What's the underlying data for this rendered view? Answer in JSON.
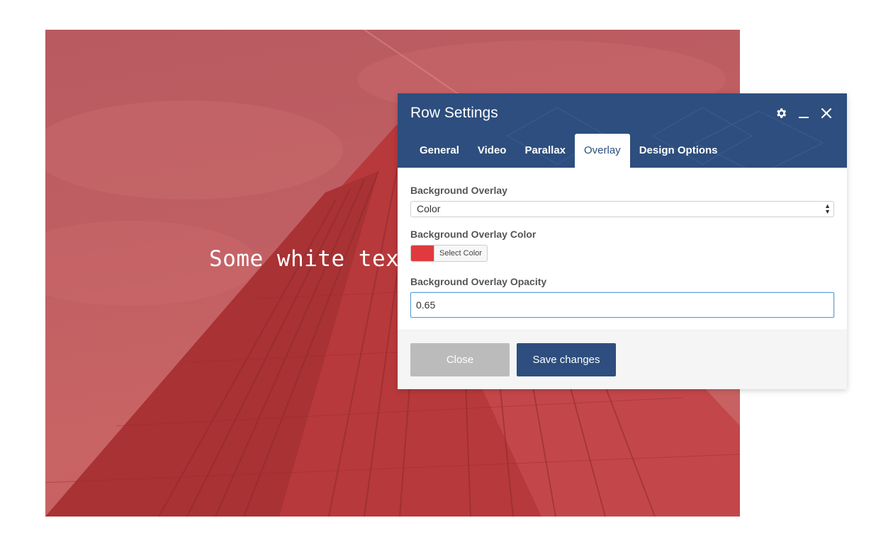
{
  "hero": {
    "text": "Some white tex"
  },
  "modal": {
    "title": "Row Settings",
    "icons": [
      "gear-icon",
      "minimize-icon",
      "close-icon"
    ],
    "tabs": [
      {
        "label": "General",
        "active": false
      },
      {
        "label": "Video",
        "active": false
      },
      {
        "label": "Parallax",
        "active": false
      },
      {
        "label": "Overlay",
        "active": true
      },
      {
        "label": "Design Options",
        "active": false
      }
    ],
    "fields": {
      "overlay": {
        "label": "Background Overlay",
        "value": "Color"
      },
      "overlay_color": {
        "label": "Background Overlay Color",
        "button_label": "Select Color",
        "swatch": "#e03a3e"
      },
      "overlay_opacity": {
        "label": "Background Overlay Opacity",
        "value": "0.65"
      }
    },
    "footer": {
      "close_label": "Close",
      "save_label": "Save changes"
    }
  },
  "colors": {
    "header": "#2d4e7e",
    "overlay_tint": "#c95a5c",
    "close_button": "#bbbbbb",
    "save_button": "#2d4e7e"
  }
}
